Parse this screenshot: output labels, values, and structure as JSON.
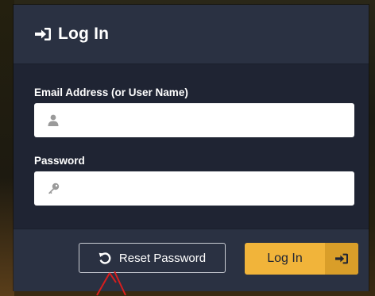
{
  "header": {
    "title": "Log In",
    "icon": "sign-in-icon"
  },
  "form": {
    "email_label": "Email Address (or User Name)",
    "email_value": "",
    "email_icon": "user-icon",
    "password_label": "Password",
    "password_value": "",
    "password_icon": "key-icon"
  },
  "actions": {
    "reset_label": "Reset Password",
    "reset_icon": "undo-icon",
    "login_label": "Log In",
    "login_icon": "sign-in-icon"
  },
  "colors": {
    "panel": "#1f2433",
    "header": "#2a3142",
    "accent": "#f1b43a",
    "accent_dark": "#d99e29",
    "annotation": "#d81e1e"
  }
}
